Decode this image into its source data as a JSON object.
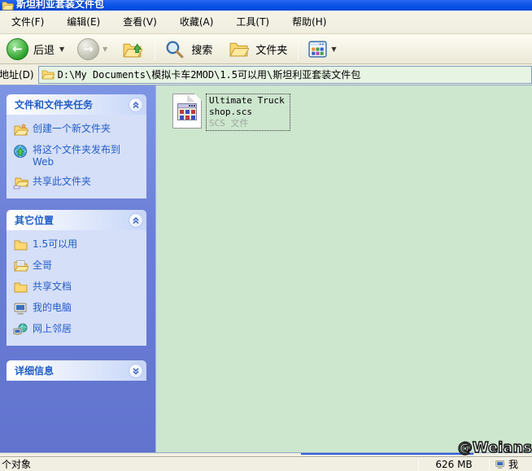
{
  "window": {
    "title": "斯坦利亚套装文件包",
    "icon": "folder-icon"
  },
  "menubar": {
    "items": [
      "文件(F)",
      "编辑(E)",
      "查看(V)",
      "收藏(A)",
      "工具(T)",
      "帮助(H)"
    ]
  },
  "toolbar": {
    "back_label": "后退",
    "search_label": "搜索",
    "folders_label": "文件夹",
    "icons": [
      "back-icon",
      "forward-icon",
      "up-folder-icon",
      "search-icon",
      "folders-icon",
      "views-icon"
    ]
  },
  "addressbar": {
    "label": "地址(D)",
    "path": "D:\\My Documents\\模拟卡车2MOD\\1.5可以用\\斯坦利亚套装文件包",
    "field_icon": "folder-icon"
  },
  "sidebar": {
    "panels": [
      {
        "title": "文件和文件夹任务",
        "collapsed": false,
        "chevron": "double-chevron-up",
        "items": [
          {
            "label": "创建一个新文件夹",
            "icon": "new-folder-icon"
          },
          {
            "label": "将这个文件夹发布到 Web",
            "icon": "publish-web-icon"
          },
          {
            "label": "共享此文件夹",
            "icon": "share-folder-icon"
          }
        ]
      },
      {
        "title": "其它位置",
        "collapsed": false,
        "chevron": "double-chevron-up",
        "items": [
          {
            "label": "1.5可以用",
            "icon": "folder-icon"
          },
          {
            "label": "全哥",
            "icon": "documents-folder-icon"
          },
          {
            "label": "共享文档",
            "icon": "shared-documents-icon"
          },
          {
            "label": "我的电脑",
            "icon": "my-computer-icon"
          },
          {
            "label": "网上邻居",
            "icon": "network-places-icon"
          }
        ]
      },
      {
        "title": "详细信息",
        "collapsed": true,
        "chevron": "double-chevron-down",
        "items": []
      }
    ]
  },
  "content": {
    "files": [
      {
        "name": "Ultimate Truck shop.scs",
        "type": "SCS 文件",
        "icon": "unknown-file-icon",
        "selected": true
      }
    ]
  },
  "statusbar": {
    "objects_label": "个对象",
    "size": "626 MB",
    "location": "我",
    "location_icon": "my-computer-icon"
  },
  "watermark": {
    "text": "@Weians"
  },
  "colors": {
    "titlebar_blue": "#0A53E8",
    "sidebar_blue": "#6B7FD6",
    "panel_body": "#D6DFF8",
    "link_blue": "#215DC6",
    "content_green": "#CDE6CE",
    "chrome_tan": "#F1EFE2"
  }
}
